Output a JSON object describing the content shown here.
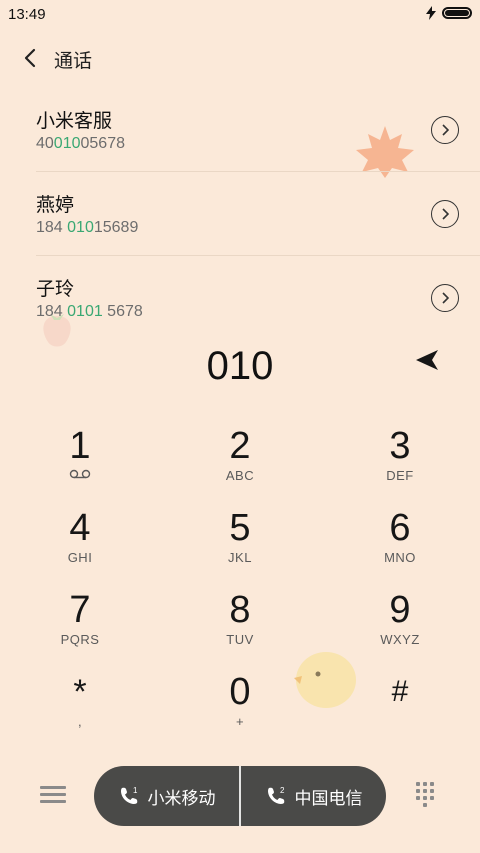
{
  "status": {
    "time": "13:49"
  },
  "header": {
    "title": "通话"
  },
  "contacts": [
    {
      "name": "小米客服",
      "number_pre": "40",
      "number_hl": "010",
      "number_post": "05678"
    },
    {
      "name": "燕婷",
      "number_pre": "184 ",
      "number_hl": "010",
      "number_post": "15689"
    },
    {
      "name": "子玲",
      "number_pre": "184 ",
      "number_hl": "0101",
      "number_post": " 5678"
    }
  ],
  "dialer": {
    "digits": "010"
  },
  "keypad": [
    {
      "num": "1",
      "sub": ""
    },
    {
      "num": "2",
      "sub": "ABC"
    },
    {
      "num": "3",
      "sub": "DEF"
    },
    {
      "num": "4",
      "sub": "GHI"
    },
    {
      "num": "5",
      "sub": "JKL"
    },
    {
      "num": "6",
      "sub": "MNO"
    },
    {
      "num": "7",
      "sub": "PQRS"
    },
    {
      "num": "8",
      "sub": "TUV"
    },
    {
      "num": "9",
      "sub": "WXYZ"
    },
    {
      "num": "*",
      "sub": ","
    },
    {
      "num": "0",
      "sub": "+"
    },
    {
      "num": "#",
      "sub": ""
    }
  ],
  "call_buttons": [
    {
      "label": "小米移动",
      "sim": "1"
    },
    {
      "label": "中国电信",
      "sim": "2"
    }
  ],
  "icons": {
    "back": "chevron-left-icon",
    "info": "chevron-right-circle-icon",
    "send": "send-arrow-icon",
    "voicemail": "voicemail-icon",
    "menu": "menu-icon",
    "keypad": "keypad-grid-icon",
    "phone": "phone-sim-icon"
  },
  "colors": {
    "background": "#fbe9d9",
    "highlight": "#3aa873",
    "call_pill": "#4a4a48"
  }
}
